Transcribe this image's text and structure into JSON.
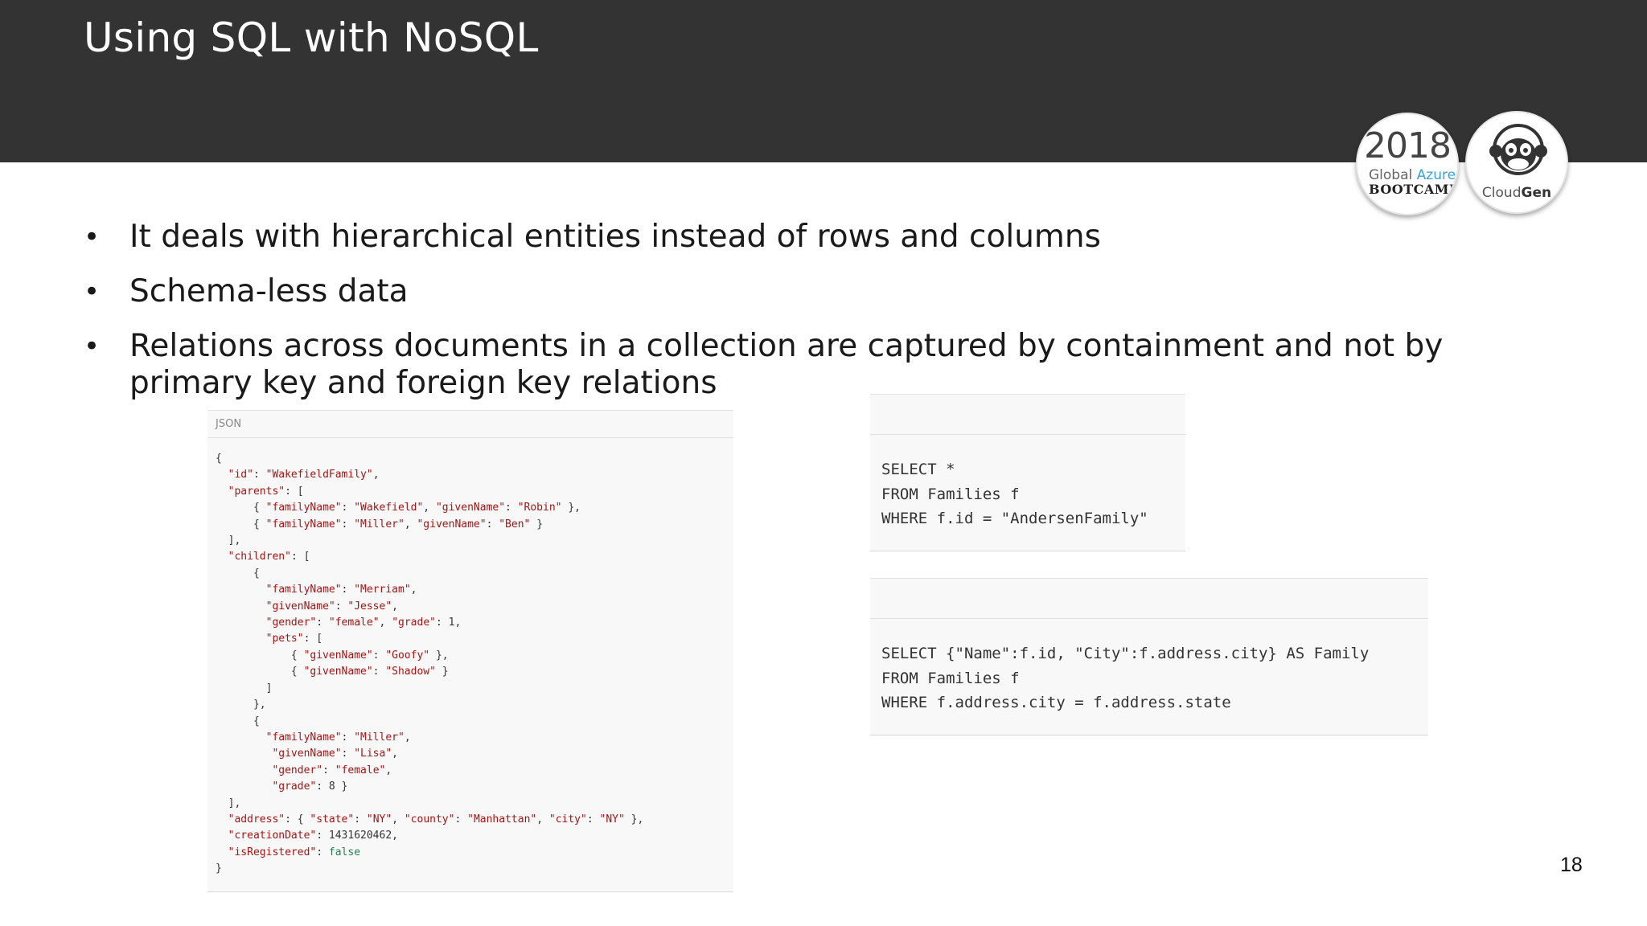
{
  "header": {
    "title": "Using SQL with NoSQL"
  },
  "logos": {
    "bootcamp": {
      "year": "2018",
      "global": "Global",
      "azure": "Azure",
      "bootcamp": "BOOTCAMP"
    },
    "cloudgen": {
      "cloud": "Cloud",
      "gen": "Gen",
      "icon": "monkey-icon"
    }
  },
  "bullets": [
    "It deals with hierarchical entities instead of rows and columns",
    "Schema-less data",
    "Relations across documents in a collection are captured by containment and not by primary key and foreign key relations"
  ],
  "json_panel": {
    "label": "JSON",
    "code": [
      "{",
      "  \"id\": \"WakefieldFamily\",",
      "  \"parents\": [",
      "      { \"familyName\": \"Wakefield\", \"givenName\": \"Robin\" },",
      "      { \"familyName\": \"Miller\", \"givenName\": \"Ben\" }",
      "  ],",
      "  \"children\": [",
      "      {",
      "        \"familyName\": \"Merriam\",",
      "        \"givenName\": \"Jesse\",",
      "        \"gender\": \"female\", \"grade\": 1,",
      "        \"pets\": [",
      "            { \"givenName\": \"Goofy\" },",
      "            { \"givenName\": \"Shadow\" }",
      "        ]",
      "      },",
      "      {",
      "        \"familyName\": \"Miller\",",
      "         \"givenName\": \"Lisa\",",
      "         \"gender\": \"female\",",
      "         \"grade\": 8 }",
      "  ],",
      "  \"address\": { \"state\": \"NY\", \"county\": \"Manhattan\", \"city\": \"NY\" },",
      "  \"creationDate\": 1431620462,",
      "  \"isRegistered\": false",
      "}"
    ]
  },
  "sql_panels": [
    {
      "code": [
        "SELECT *",
        "FROM Families f",
        "WHERE f.id = \"AndersenFamily\""
      ]
    },
    {
      "code": [
        "SELECT {\"Name\":f.id, \"City\":f.address.city} AS Family",
        "FROM Families f",
        "WHERE f.address.city = f.address.state"
      ]
    }
  ],
  "footer": {
    "page_number": "18"
  },
  "colors": {
    "header_bg": "#333333",
    "title": "#ffffff",
    "panel_bg": "#f8f8f8",
    "azure_accent": "#3aa0dd"
  }
}
